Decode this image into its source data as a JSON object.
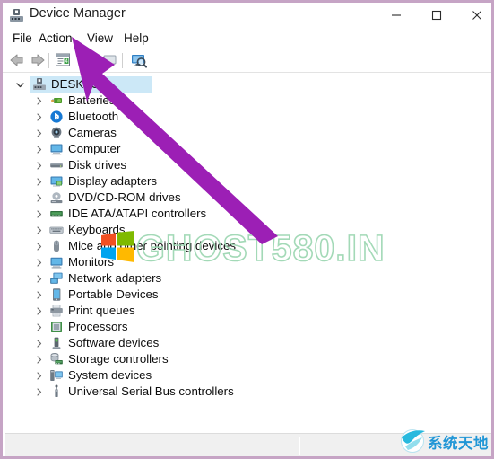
{
  "window": {
    "title": "Device Manager",
    "icon": "device-manager-icon",
    "border_color": "#c6a4c5",
    "controls": [
      {
        "name": "minimize-button",
        "glyph": "minimize-icon",
        "label": "Minimize"
      },
      {
        "name": "maximize-button",
        "glyph": "maximize-icon",
        "label": "Maximize"
      },
      {
        "name": "close-button",
        "glyph": "close-icon",
        "label": "Close"
      }
    ]
  },
  "menubar": {
    "items": [
      {
        "label": "File",
        "name": "menu-file"
      },
      {
        "label": "Action",
        "name": "menu-action"
      },
      {
        "label": "View",
        "name": "menu-view"
      },
      {
        "label": "Help",
        "name": "menu-help"
      }
    ]
  },
  "toolbar": {
    "buttons": [
      {
        "name": "back-button",
        "icon": "arrow-left-icon"
      },
      {
        "name": "forward-button",
        "icon": "arrow-right-icon"
      },
      {
        "name": "properties-button",
        "icon": "properties-icon"
      },
      {
        "name": "scan-hardware-button",
        "icon": "scan-hardware-icon"
      },
      {
        "name": "update-driver-button",
        "icon": "update-driver-icon"
      },
      {
        "name": "show-hidden-button",
        "icon": "monitor-search-icon"
      }
    ]
  },
  "tree": {
    "root": {
      "label": "DESKTOP-",
      "icon": "computer-node-icon",
      "expanded": true,
      "selected": true
    },
    "items": [
      {
        "label": "Batteries",
        "icon": "battery-icon"
      },
      {
        "label": "Bluetooth",
        "icon": "bluetooth-icon"
      },
      {
        "label": "Cameras",
        "icon": "camera-icon"
      },
      {
        "label": "Computer",
        "icon": "computer-icon"
      },
      {
        "label": "Disk drives",
        "icon": "disk-drive-icon"
      },
      {
        "label": "Display adapters",
        "icon": "display-adapter-icon"
      },
      {
        "label": "DVD/CD-ROM drives",
        "icon": "dvd-drive-icon"
      },
      {
        "label": "IDE ATA/ATAPI controllers",
        "icon": "ide-controller-icon"
      },
      {
        "label": "Keyboards",
        "icon": "keyboard-icon"
      },
      {
        "label": "Mice and other pointing devices",
        "icon": "mouse-icon"
      },
      {
        "label": "Monitors",
        "icon": "monitor-icon"
      },
      {
        "label": "Network adapters",
        "icon": "network-adapter-icon"
      },
      {
        "label": "Portable Devices",
        "icon": "portable-device-icon"
      },
      {
        "label": "Print queues",
        "icon": "printer-icon"
      },
      {
        "label": "Processors",
        "icon": "processor-icon"
      },
      {
        "label": "Software devices",
        "icon": "software-device-icon"
      },
      {
        "label": "Storage controllers",
        "icon": "storage-controller-icon"
      },
      {
        "label": "System devices",
        "icon": "system-device-icon"
      },
      {
        "label": "Universal Serial Bus controllers",
        "icon": "usb-controller-icon"
      }
    ]
  },
  "statusbar": {
    "left_text": "",
    "right_text": ""
  },
  "overlays": {
    "arrow": {
      "name": "pointer-arrow-annotation",
      "color": "#9c1fb5",
      "points_to": "Action"
    },
    "ghost_watermark": {
      "text": "GHOST580.IN",
      "color": "#9fd8b4"
    },
    "windows_logo": {
      "name": "windows-logo-watermark"
    },
    "site_watermark": {
      "text": "系统天地",
      "color": "#2196d6"
    }
  }
}
